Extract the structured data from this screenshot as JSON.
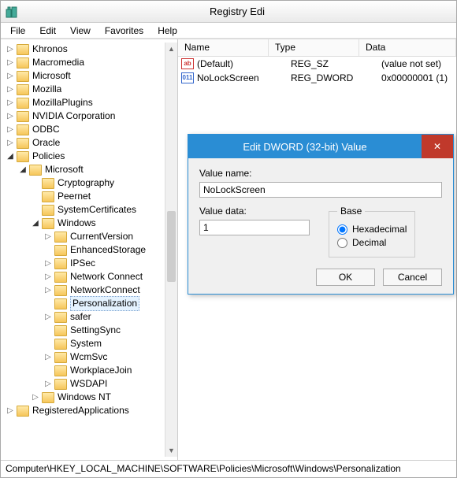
{
  "app_title": "Registry Edi",
  "menu": {
    "file": "File",
    "edit": "Edit",
    "view": "View",
    "favorites": "Favorites",
    "help": "Help"
  },
  "tree": [
    {
      "indent": 0,
      "arrow": "right",
      "label": "Khronos"
    },
    {
      "indent": 0,
      "arrow": "right",
      "label": "Macromedia"
    },
    {
      "indent": 0,
      "arrow": "right",
      "label": "Microsoft"
    },
    {
      "indent": 0,
      "arrow": "right",
      "label": "Mozilla"
    },
    {
      "indent": 0,
      "arrow": "right",
      "label": "MozillaPlugins"
    },
    {
      "indent": 0,
      "arrow": "right",
      "label": "NVIDIA Corporation"
    },
    {
      "indent": 0,
      "arrow": "right",
      "label": "ODBC"
    },
    {
      "indent": 0,
      "arrow": "right",
      "label": "Oracle"
    },
    {
      "indent": 0,
      "arrow": "down",
      "label": "Policies"
    },
    {
      "indent": 1,
      "arrow": "down",
      "label": "Microsoft"
    },
    {
      "indent": 2,
      "arrow": "blank",
      "label": "Cryptography"
    },
    {
      "indent": 2,
      "arrow": "blank",
      "label": "Peernet"
    },
    {
      "indent": 2,
      "arrow": "blank",
      "label": "SystemCertificates"
    },
    {
      "indent": 2,
      "arrow": "down",
      "label": "Windows"
    },
    {
      "indent": 3,
      "arrow": "right",
      "label": "CurrentVersion"
    },
    {
      "indent": 3,
      "arrow": "blank",
      "label": "EnhancedStorage"
    },
    {
      "indent": 3,
      "arrow": "right",
      "label": "IPSec"
    },
    {
      "indent": 3,
      "arrow": "right",
      "label": "Network Connect"
    },
    {
      "indent": 3,
      "arrow": "right",
      "label": "NetworkConnect"
    },
    {
      "indent": 3,
      "arrow": "blank",
      "label": "Personalization",
      "selected": true
    },
    {
      "indent": 3,
      "arrow": "right",
      "label": "safer"
    },
    {
      "indent": 3,
      "arrow": "blank",
      "label": "SettingSync"
    },
    {
      "indent": 3,
      "arrow": "blank",
      "label": "System"
    },
    {
      "indent": 3,
      "arrow": "right",
      "label": "WcmSvc"
    },
    {
      "indent": 3,
      "arrow": "blank",
      "label": "WorkplaceJoin"
    },
    {
      "indent": 3,
      "arrow": "right",
      "label": "WSDAPI"
    },
    {
      "indent": 2,
      "arrow": "right",
      "label": "Windows NT"
    },
    {
      "indent": 0,
      "arrow": "right",
      "label": "RegisteredApplications"
    }
  ],
  "list_headers": {
    "name": "Name",
    "type": "Type",
    "data": "Data"
  },
  "list_rows": [
    {
      "icon": "str",
      "name": "(Default)",
      "type": "REG_SZ",
      "data": "(value not set)"
    },
    {
      "icon": "bin",
      "name": "NoLockScreen",
      "type": "REG_DWORD",
      "data": "0x00000001 (1)"
    }
  ],
  "dialog": {
    "title": "Edit DWORD (32-bit) Value",
    "value_name_label": "Value name:",
    "value_name": "NoLockScreen",
    "value_data_label": "Value data:",
    "value_data": "1",
    "base_label": "Base",
    "hex": "Hexadecimal",
    "dec": "Decimal",
    "ok": "OK",
    "cancel": "Cancel"
  },
  "statusbar": "Computer\\HKEY_LOCAL_MACHINE\\SOFTWARE\\Policies\\Microsoft\\Windows\\Personalization"
}
